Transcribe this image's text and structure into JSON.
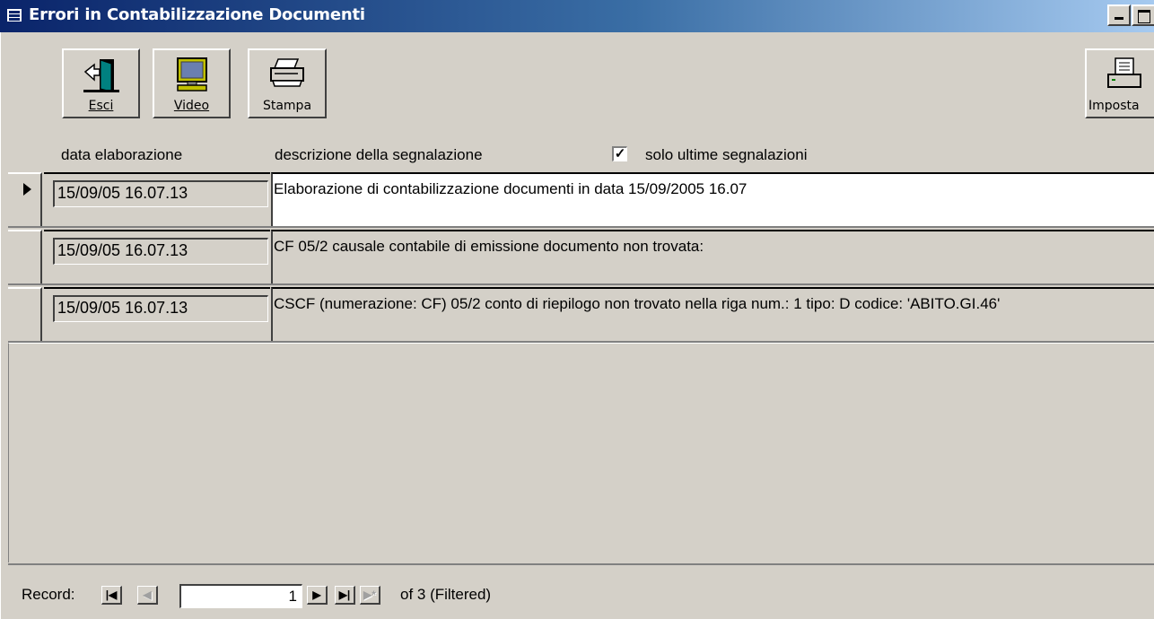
{
  "window": {
    "title": "Errori in Contabilizzazione Documenti",
    "icon": "form-icon"
  },
  "toolbar": {
    "esci": {
      "label": "Esci",
      "icon": "exit-door-icon"
    },
    "video": {
      "label": "Video",
      "icon": "monitor-icon"
    },
    "stampa": {
      "label": "Stampa",
      "icon": "printer-icon"
    },
    "imposta": {
      "label": "Imposta",
      "icon": "printer-setup-icon"
    }
  },
  "headers": {
    "data": "data elaborazione",
    "descrizione": "descrizione della segnalazione",
    "filter_label": "solo ultime segnalazioni",
    "filter_checked": true
  },
  "rows": [
    {
      "data": "15/09/05 16.07.13",
      "descrizione": "Elaborazione di contabilizzazione documenti in data 15/09/2005 16.07",
      "selected": true
    },
    {
      "data": "15/09/05 16.07.13",
      "descrizione": "CF 05/2 causale contabile di emissione documento non trovata:",
      "selected": false
    },
    {
      "data": "15/09/05 16.07.13",
      "descrizione": "CSCF (numerazione: CF) 05/2 conto di riepilogo non trovato  nella riga num.: 1 tipo: D codice: 'ABITO.GI.46'",
      "selected": false
    }
  ],
  "navigation": {
    "label": "Record:",
    "current": "1",
    "of_text": "of  3 (Filtered)"
  },
  "colors": {
    "title_start": "#0a246a",
    "title_end": "#a6caf0",
    "face": "#d4d0c8"
  }
}
